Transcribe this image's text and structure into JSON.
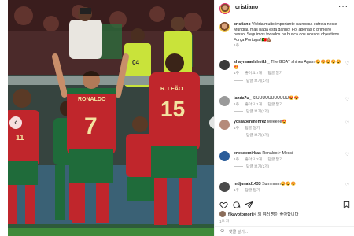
{
  "post": {
    "username": "cristiano",
    "caption_user": "cristiano",
    "caption_text": "Vitória muito importante na nossa estreia neste Mundial, mas nada está ganho! Foi apenas o primeiro passo! Seguimos focados na busca dos nossos objectivos. Força Portugal!🇵🇹💪🏽",
    "caption_time": "1주",
    "more_icon": "more-horizontal-icon",
    "date": "1주 전",
    "likes_user": "fikayotomori",
    "likes_text": "님 외 여러 명이 좋아합니다",
    "comment_placeholder": "댓글 달기...",
    "photo_jersey_numbers": [
      "7",
      "15",
      "11"
    ],
    "photo_jersey_name": "RONALDO",
    "photo_jersey_name2": "R. LEÃO",
    "photo_sleeve_badge": "04"
  },
  "comments": [
    {
      "user": "shaymaaelsheikh_",
      "text": "The GOAT shines Again 😍😍😍😍😍😍",
      "time": "1주",
      "likes": "좋아요 7개",
      "reply": "답글 달기",
      "replies": "답글 보기(2개)"
    },
    {
      "user": "landa7u_",
      "text": "SIUUUUUUUUUUU😍😍",
      "time": "1주",
      "likes": "좋아요 1개",
      "reply": "답글 달기",
      "replies": "답글 보기(3개)"
    },
    {
      "user": "yosrabenmehrez",
      "text": "Meeeee😍",
      "time": "1주",
      "likes": "",
      "reply": "답글 달기",
      "replies": "답글 보기(1개)"
    },
    {
      "user": "enesdemirbas",
      "text": "Ronaldo > Messi",
      "time": "1주",
      "likes": "좋아요 2개",
      "reply": "답글 달기",
      "replies": "답글 보기(2개)"
    },
    {
      "user": "mdjunaid1433",
      "text": "Summmm😍😍😍",
      "time": "1주",
      "likes": "",
      "reply": "답글 달기",
      "replies": ""
    }
  ],
  "icons": {
    "like": "heart-icon",
    "comment": "comment-icon",
    "share": "share-icon",
    "save": "bookmark-icon",
    "emoji": "smile-icon"
  },
  "colors": {
    "portugal_red": "#c0262c",
    "portugal_green": "#1f6b3a",
    "instagram_gray": "#8e8e8e",
    "text": "#262626"
  }
}
